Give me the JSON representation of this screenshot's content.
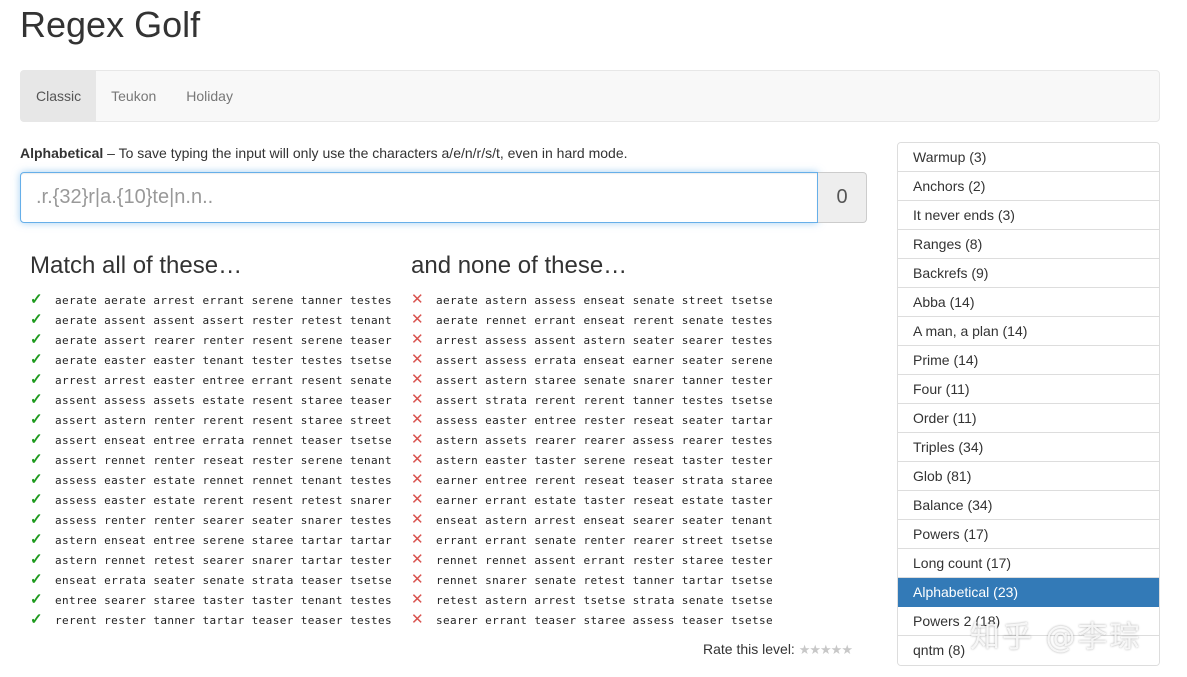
{
  "page_title": "Regex Golf",
  "tabs": [
    "Classic",
    "Teukon",
    "Holiday"
  ],
  "active_tab": 0,
  "level_description": {
    "name": "Alphabetical",
    "text": " – To save typing the input will only use the characters a/e/n/r/s/t, even in hard mode."
  },
  "regex_input": {
    "placeholder": ".r.{32}r|a.{10}te|n.n..",
    "value": ""
  },
  "score": "0",
  "match_heading": "Match all of these…",
  "none_heading": "and none of these…",
  "check_symbol": "✓",
  "cross_symbol": "✕",
  "match_rows": [
    "aerate aerate arrest errant serene tanner testes",
    "aerate assent assent assert rester retest tenant",
    "aerate assert rearer renter resent serene teaser",
    "aerate easter easter tenant tester testes tsetse",
    "arrest arrest easter entree errant resent senate",
    "assent assess assets estate resent staree teaser",
    "assert astern renter rerent resent staree street",
    "assert enseat entree errata rennet teaser tsetse",
    "assert rennet renter reseat rester serene tenant",
    "assess easter estate rennet rennet tenant testes",
    "assess easter estate rerent resent retest snarer",
    "assess renter renter searer seater snarer testes",
    "astern enseat entree serene staree tartar tartar",
    "astern rennet retest searer snarer tartar tester",
    "enseat errata seater senate strata teaser tsetse",
    "entree searer staree taster taster tenant testes",
    "rerent rester tanner tartar teaser teaser testes"
  ],
  "none_rows": [
    "aerate astern assess enseat senate street tsetse",
    "aerate rennet errant enseat rerent senate testes",
    "arrest assess assent astern seater searer testes",
    "assert assess errata enseat earner seater serene",
    "assert astern staree senate snarer tanner tester",
    "assert strata rerent rerent tanner testes tsetse",
    "assess easter entree rester reseat seater tartar",
    "astern assets rearer rearer assess rearer testes",
    "astern easter taster serene reseat taster tester",
    "earner entree rerent reseat teaser strata staree",
    "earner errant estate taster reseat estate taster",
    "enseat astern arrest enseat searer seater tenant",
    "errant errant senate renter rearer street tsetse",
    "rennet rennet assent errant rester staree tester",
    "rennet snarer senate retest tanner tartar tsetse",
    "retest astern arrest tsetse strata senate tsetse",
    "searer errant teaser staree assess teaser tsetse"
  ],
  "rate_label": "Rate this level:",
  "stars": "★★★★★",
  "levels": [
    "Warmup (3)",
    "Anchors (2)",
    "It never ends (3)",
    "Ranges (8)",
    "Backrefs (9)",
    "Abba (14)",
    "A man, a plan (14)",
    "Prime (14)",
    "Four (11)",
    "Order (11)",
    "Triples (34)",
    "Glob (81)",
    "Balance (34)",
    "Powers (17)",
    "Long count (17)",
    "Alphabetical (23)",
    "Powers 2 (18)",
    "qntm (8)"
  ],
  "active_level": 15,
  "watermark": "知乎 @李琮",
  "colors": {
    "accent": "#337ab7",
    "check": "#1e9a1e",
    "cross": "#d9534f"
  }
}
